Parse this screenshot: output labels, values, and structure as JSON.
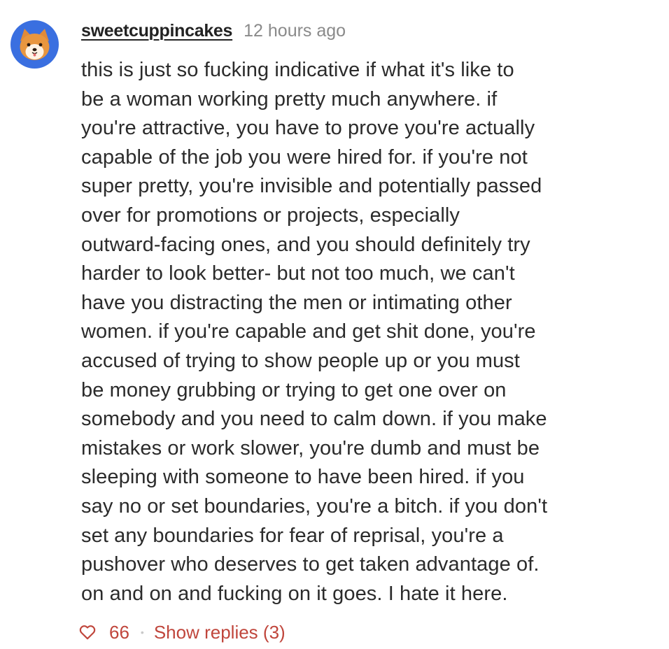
{
  "comment": {
    "avatar_icon": "dog-face-icon",
    "username": "sweetcuppincakes",
    "timestamp": "12 hours ago",
    "body_lines": [
      "this is just so fucking indicative if what it's like to",
      "be a woman working pretty much anywhere. if",
      "you're attractive, you have to prove you're actually",
      "capable of the job you were hired for. if you're not",
      "super pretty, you're invisible and potentially passed",
      "over for promotions or projects, especially",
      "outward-facing ones, and you should definitely try",
      "harder to look better- but not too much, we can't",
      "have you distracting the men or intimating other",
      "women. if you're capable and get shit done, you're",
      "accused of trying to show people up or you must",
      "be money grubbing or trying to get one over on",
      "somebody and you need to calm down. if you make",
      "mistakes or work slower, you're dumb and must be",
      "sleeping with someone to have been hired. if you",
      "say no or set boundaries, you're a bitch. if you don't",
      "set any boundaries for fear of reprisal, you're a",
      "pushover who deserves to get taken advantage of.",
      "on and on and fucking on it goes. I hate it here."
    ],
    "like_count": "66",
    "separator": "•",
    "show_replies_label": "Show replies (3)"
  },
  "colors": {
    "accent": "#c0463c",
    "avatar_bg": "#3a6fe0",
    "muted": "#8a8a8a"
  }
}
